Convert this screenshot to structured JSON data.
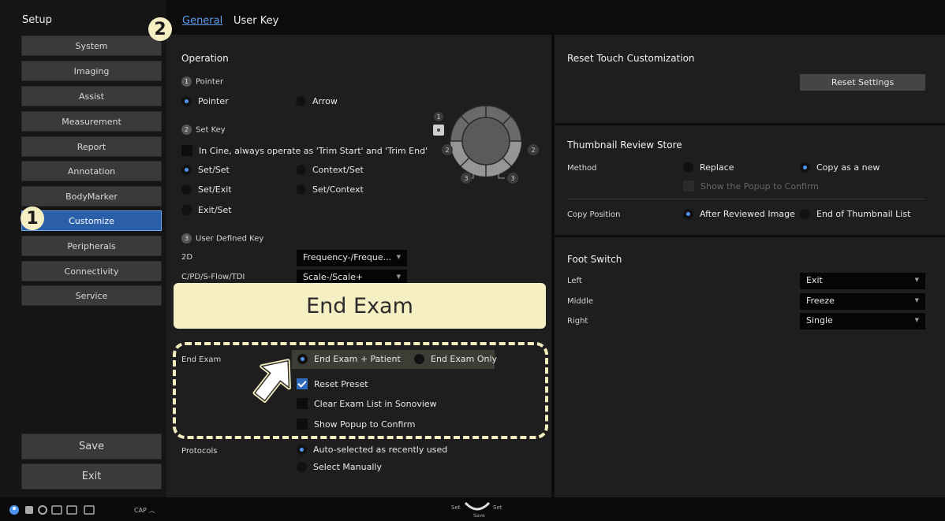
{
  "sidebar": {
    "title": "Setup",
    "items": [
      {
        "label": "System"
      },
      {
        "label": "Imaging"
      },
      {
        "label": "Assist"
      },
      {
        "label": "Measurement"
      },
      {
        "label": "Report"
      },
      {
        "label": "Annotation"
      },
      {
        "label": "BodyMarker"
      },
      {
        "label": "Customize",
        "active": true
      },
      {
        "label": "Peripherals"
      },
      {
        "label": "Connectivity"
      },
      {
        "label": "Service"
      }
    ],
    "save_label": "Save",
    "exit_label": "Exit"
  },
  "tabs": [
    {
      "label": "General",
      "active": true
    },
    {
      "label": "User Key"
    }
  ],
  "badges": {
    "one": "1",
    "two": "2"
  },
  "operation": {
    "title": "Operation",
    "pointer_section": {
      "num": "1",
      "label": "Pointer",
      "opt_pointer": "Pointer",
      "opt_arrow": "Arrow",
      "selected": "Pointer"
    },
    "setkey_section": {
      "num": "2",
      "label": "Set Key",
      "cine_check": "In Cine, always operate as 'Trim Start' and 'Trim End'",
      "opt_set_set": "Set/Set",
      "opt_context_set": "Context/Set",
      "opt_set_exit": "Set/Exit",
      "opt_set_context": "Set/Context",
      "opt_exit_set": "Exit/Set",
      "selected": "Set/Set"
    },
    "userkey_section": {
      "num": "3",
      "label": "User Defined Key",
      "row_2d_label": "2D",
      "row_2d_value": "Frequency-/Freque...",
      "row_cpd_label": "C/PD/S-Flow/TDI",
      "row_cpd_value": "Scale-/Scale+"
    },
    "diagram_labels": {
      "top": "1",
      "left": "2",
      "right": "2",
      "bl": "3",
      "br": "3"
    }
  },
  "banner_text": "End Exam",
  "end_exam": {
    "label": "End Exam",
    "opt_patient": "End Exam + Patient",
    "opt_only": "End Exam Only",
    "selected": "End Exam + Patient",
    "reset_preset": "Reset Preset",
    "clear_list": "Clear Exam List in Sonoview",
    "show_popup": "Show Popup to Confirm"
  },
  "protocols": {
    "label": "Protocols",
    "opt_auto": "Auto-selected as recently used",
    "opt_manual": "Select Manually",
    "selected": "Auto-selected as recently used"
  },
  "reset_touch": {
    "title": "Reset Touch Customization",
    "button": "Reset Settings"
  },
  "thumbnail": {
    "title": "Thumbnail Review Store",
    "method_label": "Method",
    "opt_replace": "Replace",
    "opt_copy": "Copy as a new",
    "method_selected": "Copy as a new",
    "show_popup": "Show the Popup to Confirm",
    "copy_pos_label": "Copy Position",
    "opt_after": "After Reviewed Image",
    "opt_end": "End of Thumbnail List",
    "copy_pos_selected": "After Reviewed Image"
  },
  "foot_switch": {
    "title": "Foot Switch",
    "rows": [
      {
        "label": "Left",
        "value": "Exit"
      },
      {
        "label": "Middle",
        "value": "Freeze"
      },
      {
        "label": "Right",
        "value": "Single"
      }
    ]
  },
  "bottom": {
    "cap": "CAP",
    "set_left": "Set",
    "set_right": "Set",
    "save": "Save"
  },
  "colors": {
    "accent": "#4f95f0",
    "active_nav": "#2b5fa8",
    "banner": "#f6efc4"
  }
}
